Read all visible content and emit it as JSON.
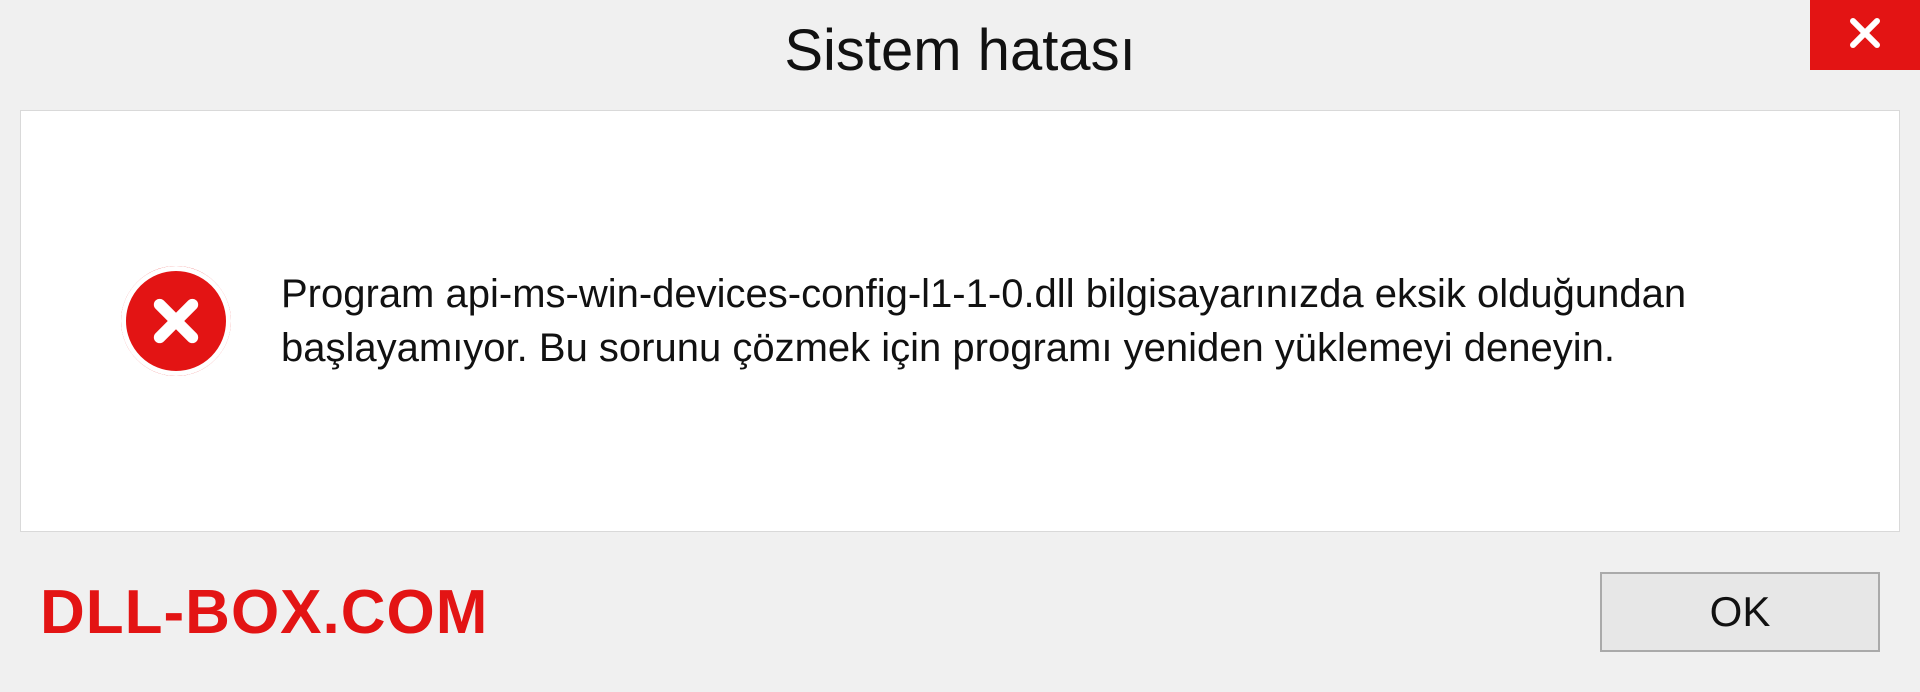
{
  "dialog": {
    "title": "Sistem hatası",
    "message": "Program api-ms-win-devices-config-l1-1-0.dll bilgisayarınızda eksik olduğundan başlayamıyor. Bu sorunu çözmek için programı yeniden yüklemeyi deneyin.",
    "ok_label": "OK"
  },
  "brand": "DLL-BOX.COM",
  "colors": {
    "accent": "#e31414"
  }
}
